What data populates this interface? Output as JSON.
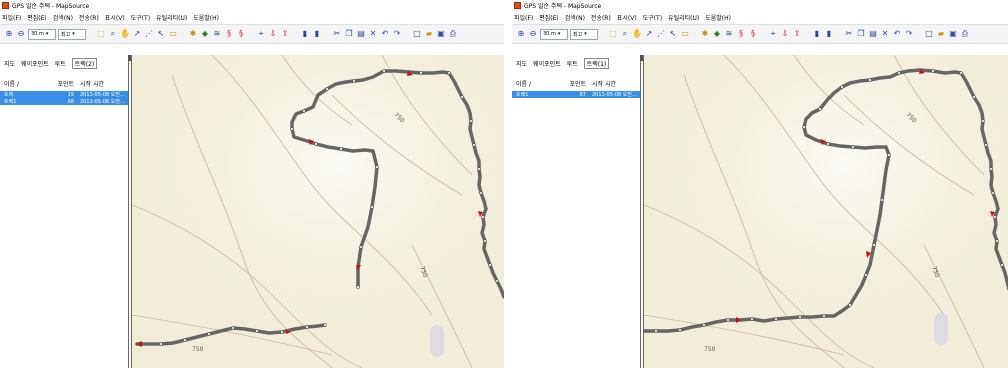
{
  "left": {
    "title": "GPS 일순 주택 - MapSource",
    "menu": [
      "파일(F)",
      "편집(E)",
      "검색(N)",
      "전송(R)",
      "표시(V)",
      "도구(T)",
      "유틸리티(U)",
      "도움말(H)"
    ],
    "zoom_value": "30 m",
    "display_value": "최고",
    "tabs": [
      "지도",
      "웨이포인트",
      "루트",
      "트랙(2)"
    ],
    "list_headers": [
      "이름 /",
      "포인트",
      "시작 시간"
    ],
    "rows": [
      {
        "name": "트랙",
        "points": "19",
        "start": "2013-05-08 오전…"
      },
      {
        "name": "트랙1",
        "points": "68",
        "start": "2013-05-08 오전…"
      }
    ],
    "contour_labels": [
      "750",
      "750",
      "750"
    ]
  },
  "right": {
    "title": "GPS 일순 주택 - MapSource",
    "menu": [
      "파일(F)",
      "편집(E)",
      "검색(N)",
      "전송(R)",
      "표시(V)",
      "도구(T)",
      "유틸리티(U)",
      "도움말(H)"
    ],
    "zoom_value": "30 m",
    "display_value": "최고",
    "tabs": [
      "지도",
      "웨이포인트",
      "루트",
      "트랙(1)"
    ],
    "list_headers": [
      "이름 /",
      "포인트",
      "시작 시간"
    ],
    "rows": [
      {
        "name": "트랙1",
        "points": "87",
        "start": "2013-05-08 오전…"
      }
    ],
    "contour_labels": [
      "750",
      "750",
      "750"
    ]
  },
  "colors": {
    "track": "#666666",
    "selection": "#3a8ee6",
    "map_bg": "#f5f0df",
    "contour": "#c9b79a",
    "marker": "#cc1111"
  }
}
